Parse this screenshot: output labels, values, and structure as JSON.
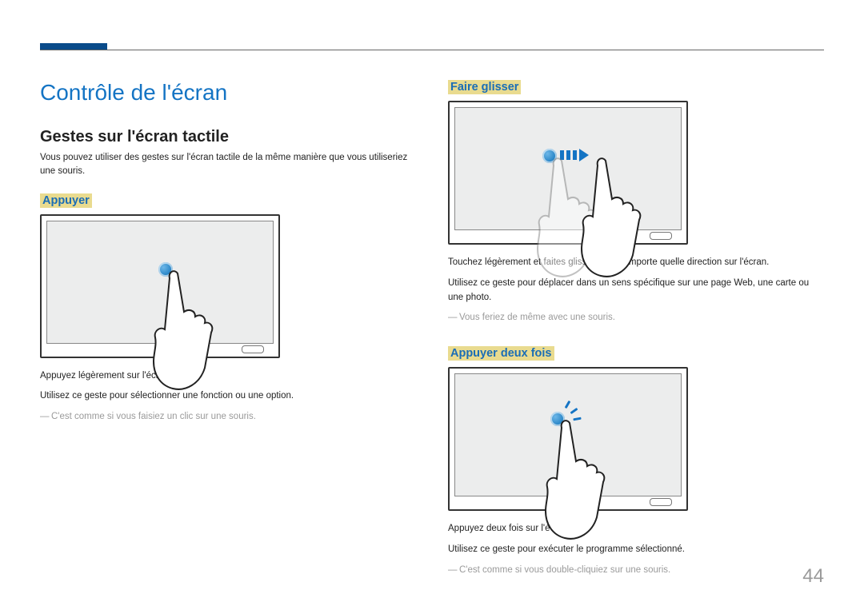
{
  "page_number": "44",
  "title": "Contrôle de l'écran",
  "subtitle": "Gestes sur l'écran tactile",
  "intro": "Vous pouvez utiliser des gestes sur l'écran tactile de la même manière que vous utiliseriez une souris.",
  "left": {
    "tap": {
      "heading": "Appuyer",
      "line1": "Appuyez légèrement sur l'écran.",
      "line2": "Utilisez ce geste pour sélectionner une fonction ou une option.",
      "note": "C'est comme si vous faisiez un clic sur une souris."
    }
  },
  "right": {
    "drag": {
      "heading": "Faire glisser",
      "line1": "Touchez légèrement et faites glisser dans n'importe quelle direction sur l'écran.",
      "line2": "Utilisez ce geste pour déplacer dans un sens spécifique sur une page Web, une carte ou une photo.",
      "note": "Vous feriez de même avec une souris."
    },
    "double_tap": {
      "heading": "Appuyer deux fois",
      "line1": "Appuyez deux fois sur l'écran.",
      "line2": "Utilisez ce geste pour exécuter le programme sélectionné.",
      "note": "C'est comme si vous double-cliquiez sur une souris."
    }
  }
}
